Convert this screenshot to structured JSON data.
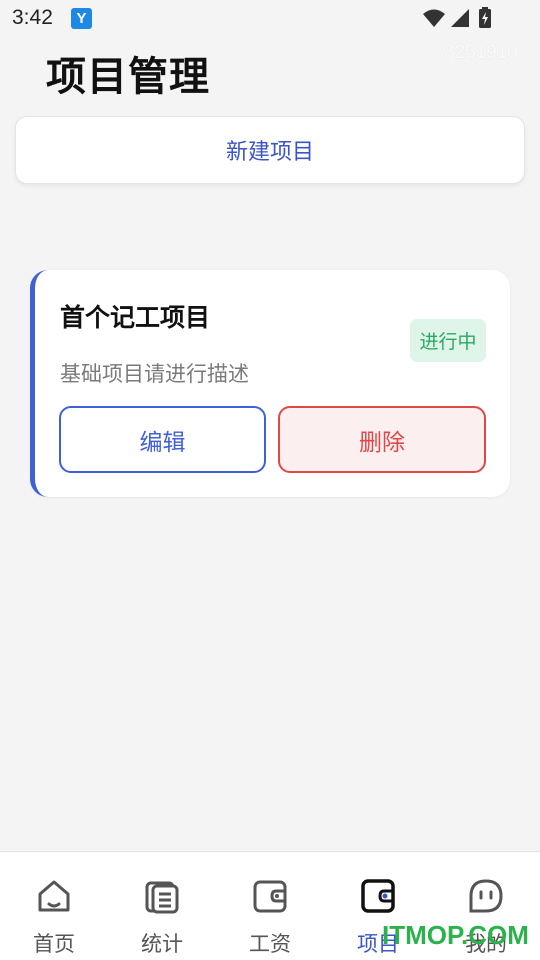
{
  "status_bar": {
    "time": "3:42",
    "app_icon_letter": "Y"
  },
  "watermark_id": "3251910",
  "page_title": "项目管理",
  "new_project_label": "新建项目",
  "project": {
    "name": "首个记工项目",
    "status": "进行中",
    "description": "基础项目请进行描述",
    "edit_label": "编辑",
    "delete_label": "删除"
  },
  "bottom_nav": [
    {
      "label": "首页",
      "icon": "home-icon",
      "active": false
    },
    {
      "label": "统计",
      "icon": "stats-icon",
      "active": false
    },
    {
      "label": "工资",
      "icon": "wallet-icon",
      "active": false
    },
    {
      "label": "项目",
      "icon": "project-icon",
      "active": true
    },
    {
      "label": "我的",
      "icon": "profile-icon",
      "active": false
    }
  ],
  "watermark_logo": "ITMOP.COM",
  "colors": {
    "accent": "#3b55c6",
    "danger": "#e04848",
    "status_green": "#2aa862",
    "background": "#f4f4f4"
  }
}
